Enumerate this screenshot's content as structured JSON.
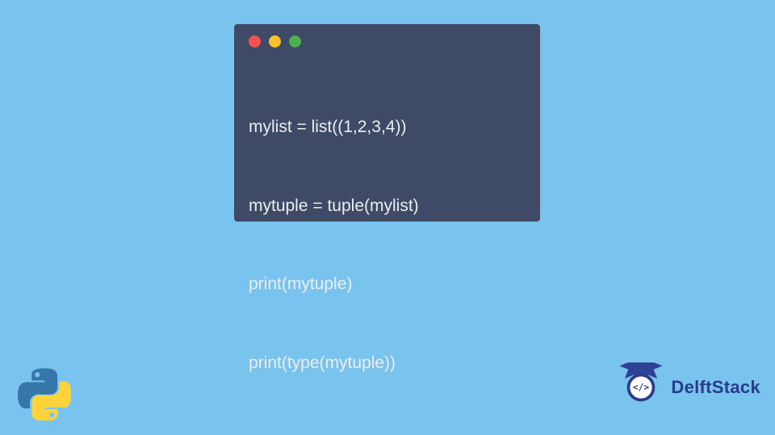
{
  "code": {
    "lines": [
      "mylist = list((1,2,3,4))",
      "mytuple = tuple(mylist)",
      "print(mytuple)",
      "print(type(mytuple))"
    ]
  },
  "branding": {
    "name": "DelftStack"
  }
}
